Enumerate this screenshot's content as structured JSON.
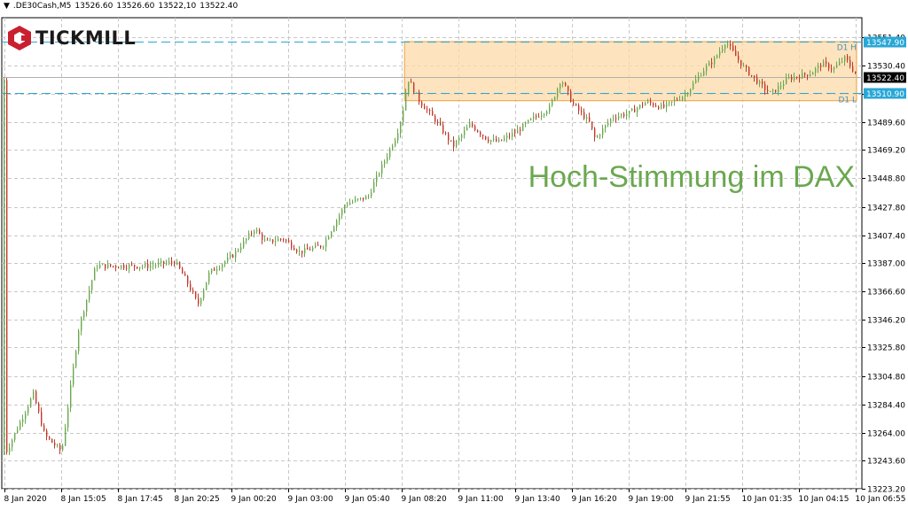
{
  "header": {
    "symbol": ".DE30Cash,M5",
    "open": "13526.60",
    "high": "13526.60",
    "low": "13522,10",
    "close": "13522.40"
  },
  "brand": {
    "name": "TICKMILL",
    "logo_icon": "tickmill-hexagon-icon",
    "color": "#c8202f"
  },
  "headline": "Hoch-Stimmung im DAX",
  "colors": {
    "headline": "#6aa84f",
    "bull_candle": "#6aa84f",
    "bear_candle": "#c0392b",
    "zone_fill": "#fcd9a8",
    "zone_line": "#f0a040",
    "level_line": "#2aa7d6",
    "level_tag": "#2aa7d6",
    "current_tag": "#000000",
    "grid": "#c8c8c8"
  },
  "chart_data": {
    "type": "candlestick",
    "ylim": [
      13223.2,
      13561.4
    ],
    "y_ticks": [
      "13551.40",
      "13530.40",
      "13510.00",
      "13489.60",
      "13469.20",
      "13448.80",
      "13427.80",
      "13407.40",
      "13387.00",
      "13366.60",
      "13346.20",
      "13325.80",
      "13304.80",
      "13284.40",
      "13264.00",
      "13243.60",
      "13223.20"
    ],
    "x_ticks": [
      "8 Jan 2020",
      "8 Jan 15:05",
      "8 Jan 17:45",
      "8 Jan 20:25",
      "9 Jan 00:20",
      "9 Jan 03:00",
      "9 Jan 05:40",
      "9 Jan 08:20",
      "9 Jan 11:00",
      "9 Jan 13:40",
      "9 Jan 16:20",
      "9 Jan 19:00",
      "9 Jan 21:55",
      "10 Jan 01:35",
      "10 Jan 04:15",
      "10 Jan 06:55"
    ],
    "levels": [
      {
        "label": "D1 H",
        "value": 13547.9,
        "tag": "13547.90"
      },
      {
        "label": "D1 L",
        "value": 13510.9,
        "tag": "13510.90"
      }
    ],
    "current_price": {
      "value": 13522.4,
      "tag": "13522.40"
    },
    "zone": {
      "from": 13505.0,
      "to": 13547.9,
      "start_index": 7.05
    },
    "path": [
      [
        0,
        13248
      ],
      [
        0.5,
        13292
      ],
      [
        0.7,
        13262
      ],
      [
        1.0,
        13250
      ],
      [
        1.3,
        13340
      ],
      [
        1.6,
        13385
      ],
      [
        2.0,
        13385
      ],
      [
        2.5,
        13385
      ],
      [
        3.0,
        13388
      ],
      [
        3.2,
        13374
      ],
      [
        3.4,
        13357
      ],
      [
        3.6,
        13380
      ],
      [
        4.0,
        13392
      ],
      [
        4.4,
        13412
      ],
      [
        4.6,
        13402
      ],
      [
        4.9,
        13405
      ],
      [
        5.2,
        13395
      ],
      [
        5.6,
        13400
      ],
      [
        6.0,
        13430
      ],
      [
        6.3,
        13434
      ],
      [
        6.4,
        13435
      ],
      [
        6.5,
        13445
      ],
      [
        6.9,
        13480
      ],
      [
        7.0,
        13495
      ],
      [
        7.1,
        13521
      ],
      [
        7.3,
        13505
      ],
      [
        7.6,
        13490
      ],
      [
        7.9,
        13472
      ],
      [
        8.2,
        13488
      ],
      [
        8.5,
        13477
      ],
      [
        8.7,
        13475
      ],
      [
        9.0,
        13482
      ],
      [
        9.3,
        13492
      ],
      [
        9.6,
        13500
      ],
      [
        9.8,
        13521
      ],
      [
        10.0,
        13503
      ],
      [
        10.3,
        13489
      ],
      [
        10.4,
        13477
      ],
      [
        10.7,
        13493
      ],
      [
        11.0,
        13496
      ],
      [
        11.3,
        13504
      ],
      [
        11.6,
        13500
      ],
      [
        12.0,
        13510
      ],
      [
        12.3,
        13527
      ],
      [
        12.5,
        13535
      ],
      [
        12.7,
        13548
      ],
      [
        13.0,
        13530
      ],
      [
        13.3,
        13517
      ],
      [
        13.5,
        13510
      ],
      [
        13.8,
        13521
      ],
      [
        14.2,
        13525
      ],
      [
        14.4,
        13532
      ],
      [
        14.6,
        13528
      ],
      [
        14.8,
        13536
      ],
      [
        15.0,
        13524
      ],
      [
        15.2,
        13520
      ]
    ]
  }
}
